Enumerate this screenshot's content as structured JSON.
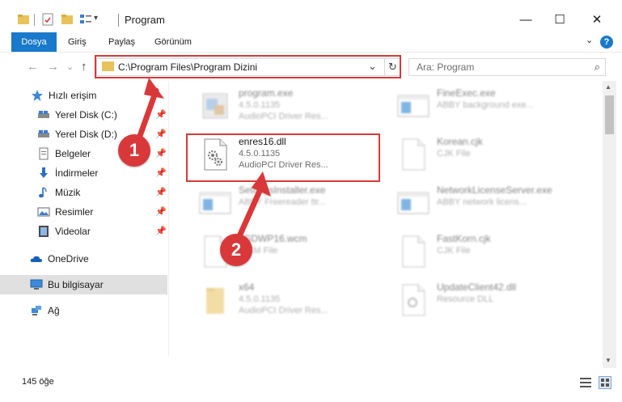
{
  "window": {
    "title": "Program",
    "minimize": "—",
    "maximize": "☐",
    "close": "✕"
  },
  "ribbon": {
    "tabs": [
      "Dosya",
      "Giriş",
      "Paylaş",
      "Görünüm"
    ],
    "expand": "⌄",
    "help": "?"
  },
  "nav": {
    "back": "←",
    "forward": "→",
    "recent": "⌄",
    "up": "↑",
    "address": "C:\\Program Files\\Program Dizini",
    "address_chevron": "⌄",
    "refresh": "↻",
    "search_placeholder": "Ara: Program",
    "search_icon": "⌕"
  },
  "sidebar": {
    "items": [
      {
        "label": "Hızlı erişim",
        "icon": "star-icon"
      },
      {
        "label": "Yerel Disk (C:)",
        "icon": "drive-icon",
        "pinned": true
      },
      {
        "label": "Yerel Disk (D:)",
        "icon": "drive-icon",
        "pinned": true
      },
      {
        "label": "Belgeler",
        "icon": "document-icon",
        "pinned": true
      },
      {
        "label": "İndirmeler",
        "icon": "download-icon",
        "pinned": true
      },
      {
        "label": "Müzik",
        "icon": "music-icon",
        "pinned": true
      },
      {
        "label": "Resimler",
        "icon": "pictures-icon",
        "pinned": true
      },
      {
        "label": "Videolar",
        "icon": "video-icon",
        "pinned": true
      },
      {
        "label": "OneDrive",
        "icon": "cloud-icon"
      },
      {
        "label": "Bu bilgisayar",
        "icon": "computer-icon",
        "selected": true
      },
      {
        "label": "Ağ",
        "icon": "network-icon"
      }
    ],
    "pin_glyph": "📌"
  },
  "files": [
    {
      "name": "program.exe",
      "line1": "4.5.0.1135",
      "line2": "AudioPCI Driver Res...",
      "blurred": true
    },
    {
      "name": "FineExec.exe",
      "line1": "ABBY background exe...",
      "line2": "",
      "blurred": true
    },
    {
      "name": "enres16.dll",
      "line1": "4.5.0.1135",
      "line2": "AudioPCI Driver Res...",
      "blurred": false
    },
    {
      "name": "Korean.cjk",
      "line1": "CJK File",
      "line2": "",
      "blurred": true
    },
    {
      "name": "SettingsInstaller.exe",
      "line1": "ABBY Freereader ttr...",
      "line2": "",
      "blurred": true
    },
    {
      "name": "NetworkLicenseServer.exe",
      "line1": "ABBY network licens...",
      "line2": "",
      "blurred": true
    },
    {
      "name": "FSDWP16.wcm",
      "line1": "WCM File",
      "line2": "",
      "blurred": true
    },
    {
      "name": "FastKorn.cjk",
      "line1": "CJK File",
      "line2": "",
      "blurred": true
    },
    {
      "name": "x64",
      "line1": "4.5.0.1135",
      "line2": "AudioPCI Driver Res...",
      "blurred": true
    },
    {
      "name": "UpdateClient42.dll",
      "line1": "Resource DLL",
      "line2": "",
      "blurred": true
    }
  ],
  "status": {
    "count": "145 öğe"
  },
  "callouts": [
    "1",
    "2"
  ],
  "colors": {
    "accent": "#1979ca",
    "callout": "#d9383a",
    "folder": "#e8c25a",
    "selected_bg": "#e0e0e0"
  }
}
